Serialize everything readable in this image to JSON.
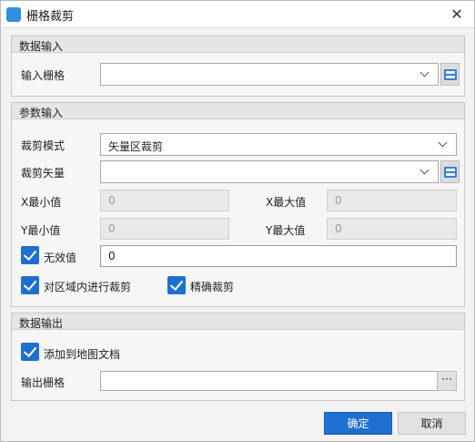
{
  "window": {
    "title": "栅格裁剪"
  },
  "data_input": {
    "title": "数据输入",
    "input_raster": {
      "label": "输入栅格",
      "value": ""
    }
  },
  "params": {
    "title": "参数输入",
    "clip_mode": {
      "label": "裁剪模式",
      "value": "矢量区裁剪"
    },
    "clip_vector": {
      "label": "裁剪矢量",
      "value": ""
    },
    "x_min": {
      "label": "X最小值",
      "value": "0"
    },
    "x_max": {
      "label": "X最大值",
      "value": "0"
    },
    "y_min": {
      "label": "Y最小值",
      "value": "0"
    },
    "y_max": {
      "label": "Y最大值",
      "value": "0"
    },
    "nodata": {
      "label": "无效值",
      "value": "0",
      "checked": true
    },
    "inside_clip": {
      "label": "对区域内进行裁剪",
      "checked": true
    },
    "exact_clip": {
      "label": "精确裁剪",
      "checked": true
    }
  },
  "data_output": {
    "title": "数据输出",
    "add_to_map": {
      "label": "添加到地图文档",
      "checked": true
    },
    "output_raster": {
      "label": "输出栅格",
      "value": "",
      "browse": "···"
    }
  },
  "buttons": {
    "ok": "确定",
    "cancel": "取消"
  },
  "colors": {
    "accent": "#1f6fd1"
  }
}
